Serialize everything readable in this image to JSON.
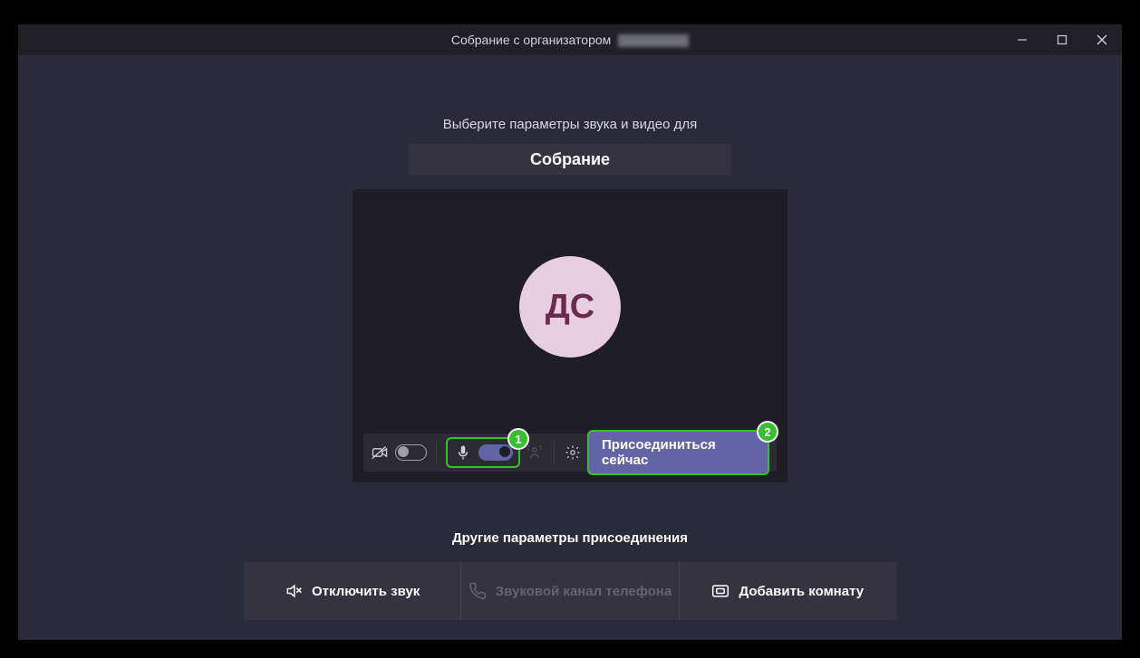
{
  "titlebar": {
    "title_prefix": "Собрание с организатором"
  },
  "setup": {
    "instruction": "Выберите параметры звука и видео для",
    "meeting_name": "Собрание"
  },
  "avatar": {
    "initials": "ДС"
  },
  "controls": {
    "camera_on": false,
    "mic_on": true,
    "join_label": "Присоединиться сейчас",
    "annotation_mic": "1",
    "annotation_join": "2"
  },
  "other": {
    "heading": "Другие параметры присоединения",
    "mute_label": "Отключить звук",
    "phone_label": "Звуковой канал телефона",
    "room_label": "Добавить комнату"
  }
}
